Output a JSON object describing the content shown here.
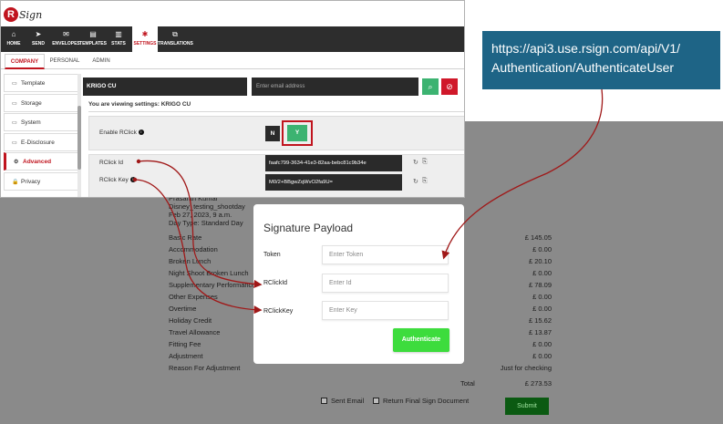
{
  "app": {
    "logo_letter": "R",
    "logo_text": "Sign",
    "nav": [
      {
        "label": "HOME",
        "icon": "home-icon",
        "glyph": "⌂"
      },
      {
        "label": "SEND",
        "icon": "send-icon",
        "glyph": "➤"
      },
      {
        "label": "ENVELOPES",
        "icon": "envelope-icon",
        "glyph": "✉"
      },
      {
        "label": "TEMPLATES",
        "icon": "templates-icon",
        "glyph": "▤"
      },
      {
        "label": "STATS",
        "icon": "stats-icon",
        "glyph": "▥"
      },
      {
        "label": "SETTINGS",
        "icon": "settings-icon",
        "glyph": "✱"
      },
      {
        "label": "TRANSLATIONS",
        "icon": "translations-icon",
        "glyph": "⧉"
      }
    ],
    "tabs": [
      "COMPANY",
      "PERSONAL",
      "ADMIN"
    ],
    "sidebar": [
      {
        "label": "Template",
        "glyph": "▭"
      },
      {
        "label": "Storage",
        "glyph": "▭"
      },
      {
        "label": "System",
        "glyph": "▭"
      },
      {
        "label": "E-Disclosure",
        "glyph": "▭"
      },
      {
        "label": "Advanced",
        "glyph": "⚙"
      },
      {
        "label": "Privacy",
        "glyph": "🔒"
      }
    ],
    "company_field": "KRIGO CU",
    "email_placeholder": "Enter email address",
    "viewing_text": "You are viewing settings: KRIGO CU",
    "enable_rclick_label": "Enable RClick",
    "toggle_n": "N",
    "toggle_y": "Y",
    "rclick_id_label": "RClick Id",
    "rclick_key_label": "RClick Key",
    "rclick_id_value": "faafc799-3634-41e3-82aa-bebc81c9b34e",
    "rclick_key_value": "M0/2+BBgwZqWvO2fa9U="
  },
  "api_url": {
    "line1": "https://api3.use.rsign.com/api/V1/",
    "line2": "Authentication/AuthenticateUser"
  },
  "document": {
    "header_lines": [
      "Prasanth Kumar",
      "Disney_testing_shootday",
      "Feb 27, 2023, 9 a.m.",
      "Day Type: Standard Day"
    ],
    "rows": [
      {
        "label": "Basic Rate",
        "amount": "£ 145.05"
      },
      {
        "label": "Accommodation",
        "amount": "£ 0.00"
      },
      {
        "label": "Broken Lunch",
        "amount": "£ 20.10"
      },
      {
        "label": "Night Shoot Broken Lunch",
        "amount": "£ 0.00"
      },
      {
        "label": "Supplementary Performance",
        "amount": "£ 78.09"
      },
      {
        "label": "Other Expenses",
        "amount": "£ 0.00"
      },
      {
        "label": "Overtime",
        "amount": "£ 0.00"
      },
      {
        "label": "Holiday Credit",
        "amount": "£ 15.62"
      },
      {
        "label": "Travel Allowance",
        "amount": "£ 13.87"
      },
      {
        "label": "Fitting Fee",
        "amount": "£ 0.00"
      },
      {
        "label": "Adjustment",
        "amount": "£ 0.00"
      },
      {
        "label": "Reason For Adjustment",
        "amount": "Just for checking"
      }
    ],
    "total_label": "Total",
    "total_amount": "£ 273.53",
    "sent_email_label": "Sent Email",
    "return_doc_label": "Return Final Sign Document",
    "submit_label": "Submit"
  },
  "payload": {
    "title": "Signature Payload",
    "token_label": "Token",
    "token_placeholder": "Enter Token",
    "rclickid_label": "RClickId",
    "rclickid_placeholder": "Enter Id",
    "rclickkey_label": "RClickKey",
    "rclickkey_placeholder": "Enter Key",
    "authenticate_label": "Authenticate"
  },
  "colors": {
    "brand_red": "#c0141e",
    "api_box": "#1e6486",
    "green": "#3cb371",
    "arrow": "#a01818"
  }
}
